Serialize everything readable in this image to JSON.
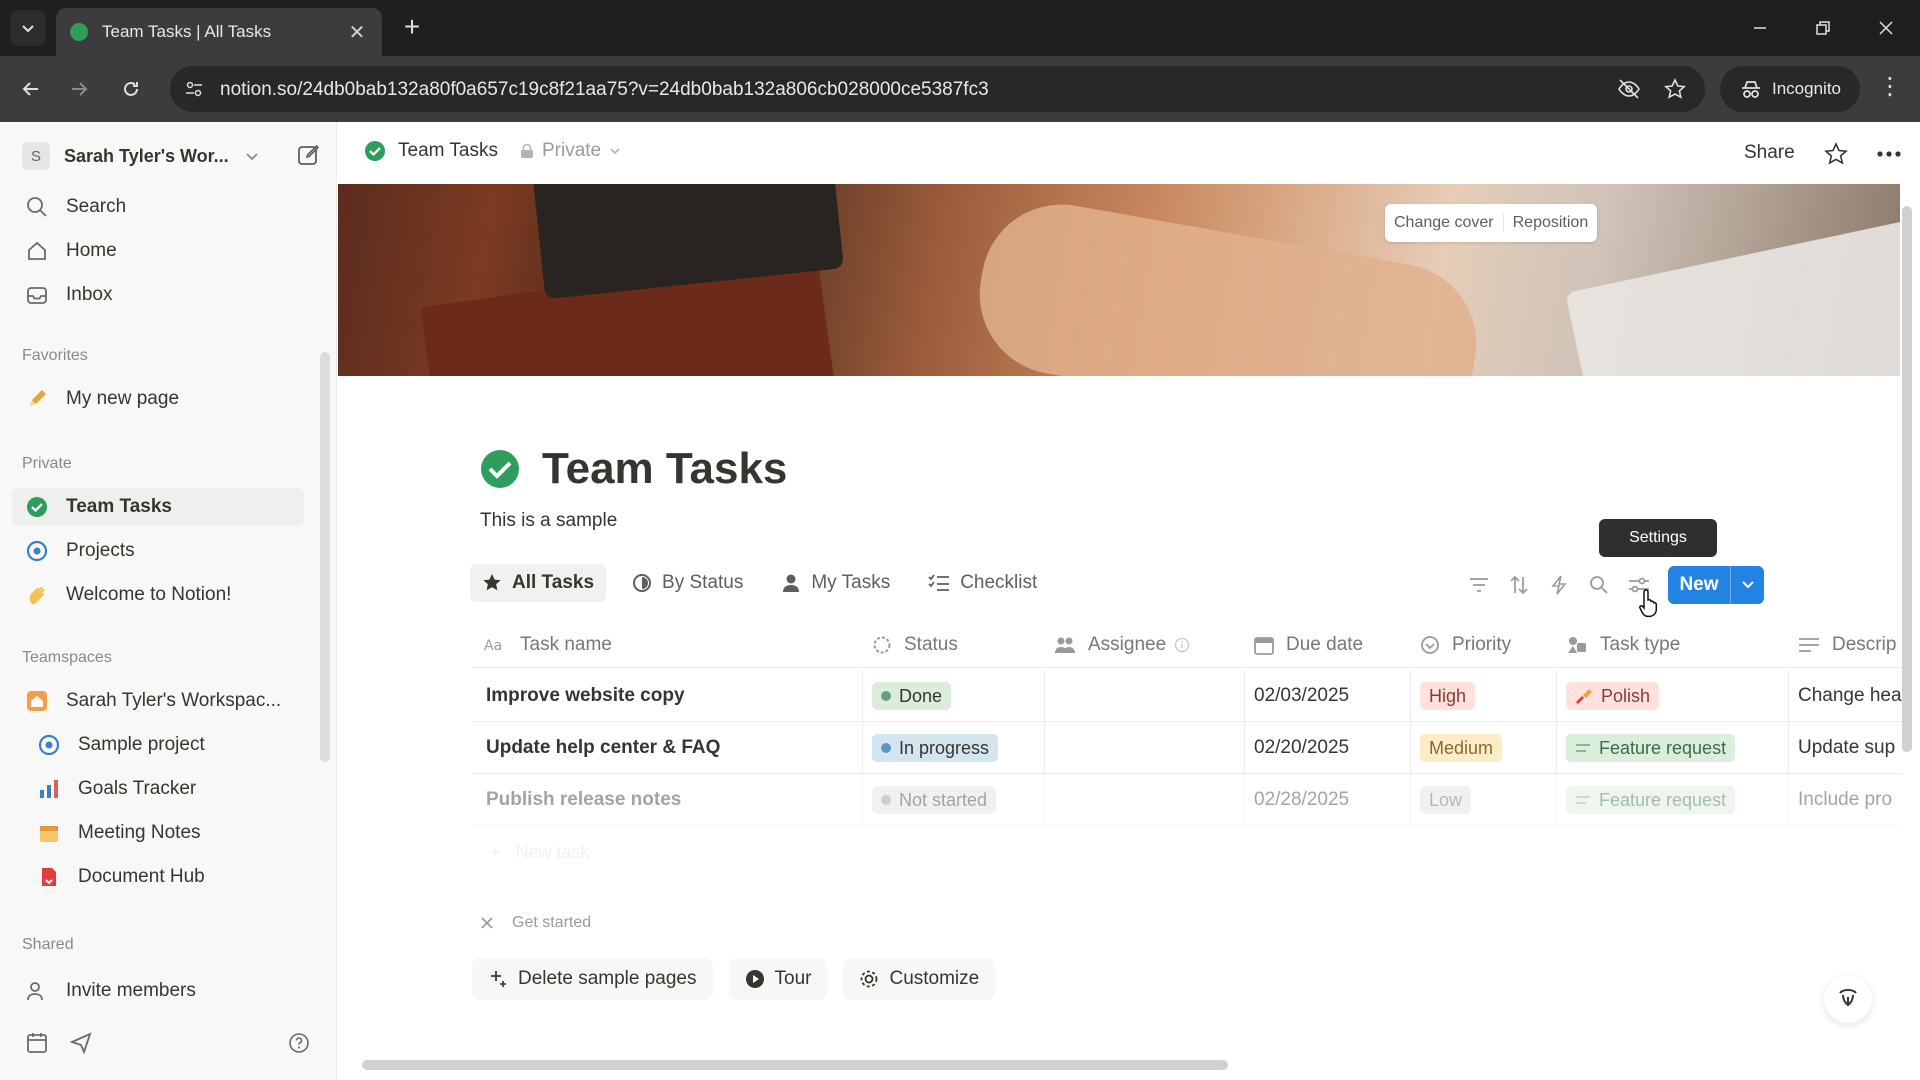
{
  "browser": {
    "tab_title": "Team Tasks | All Tasks",
    "url": "notion.so/24db0bab132a80f0a657c19c8f21aa75?v=24db0bab132a806cb028000ce5387fc3",
    "incognito_label": "Incognito"
  },
  "sidebar": {
    "workspace_initial": "S",
    "workspace_name": "Sarah Tyler's Wor...",
    "nav": [
      {
        "label": "Search",
        "icon": "search-icon"
      },
      {
        "label": "Home",
        "icon": "home-icon"
      },
      {
        "label": "Inbox",
        "icon": "inbox-icon"
      }
    ],
    "favorites_heading": "Favorites",
    "favorites": [
      {
        "label": "My new page",
        "icon": "pencil-icon"
      }
    ],
    "private_heading": "Private",
    "private": [
      {
        "label": "Team Tasks",
        "icon": "check-circle-icon"
      },
      {
        "label": "Projects",
        "icon": "target-icon"
      },
      {
        "label": "Welcome to Notion!",
        "icon": "wave-icon"
      }
    ],
    "teamspaces_heading": "Teamspaces",
    "teamspaces": [
      {
        "label": "Sarah Tyler's Workspac...",
        "icon": "house-icon"
      },
      {
        "label": "Sample project",
        "icon": "target-icon"
      },
      {
        "label": "Goals Tracker",
        "icon": "chart-icon"
      },
      {
        "label": "Meeting Notes",
        "icon": "calendar-icon"
      },
      {
        "label": "Document Hub",
        "icon": "document-icon"
      }
    ],
    "shared_heading": "Shared",
    "invite_label": "Invite members"
  },
  "topbar": {
    "page_name": "Team Tasks",
    "privacy": "Private",
    "share_label": "Share"
  },
  "cover": {
    "change_cover": "Change cover",
    "reposition": "Reposition"
  },
  "page": {
    "title": "Team Tasks",
    "description": "This is a sample"
  },
  "views": [
    {
      "label": "All Tasks",
      "icon": "star-icon"
    },
    {
      "label": "By Status",
      "icon": "status-icon"
    },
    {
      "label": "My Tasks",
      "icon": "person-icon"
    },
    {
      "label": "Checklist",
      "icon": "checklist-icon"
    }
  ],
  "toolbar": {
    "new_label": "New",
    "tooltip": "Settings"
  },
  "table": {
    "columns": [
      "Task name",
      "Status",
      "Assignee",
      "Due date",
      "Priority",
      "Task type",
      "Descrip"
    ],
    "rows": [
      {
        "name": "Improve website copy",
        "status": "Done",
        "assignee": "",
        "due": "02/03/2025",
        "priority": "High",
        "type": "Polish",
        "desc": "Change hea"
      },
      {
        "name": "Update help center & FAQ",
        "status": "In progress",
        "assignee": "",
        "due": "02/20/2025",
        "priority": "Medium",
        "type": "Feature request",
        "desc": "Update sup"
      },
      {
        "name": "Publish release notes",
        "status": "Not started",
        "assignee": "",
        "due": "02/28/2025",
        "priority": "Low",
        "type": "Feature request",
        "desc": "Include pro"
      }
    ],
    "new_task": "New task"
  },
  "get_started": {
    "label": "Get started",
    "buttons": [
      {
        "label": "Delete sample pages",
        "icon": "sparkle-icon"
      },
      {
        "label": "Tour",
        "icon": "play-icon"
      },
      {
        "label": "Customize",
        "icon": "gear-icon"
      }
    ]
  },
  "colors": {
    "accent": "#2383e2",
    "done_bg": "#dbeddb",
    "done_dot": "#6c9b7d",
    "progress_bg": "#d3e5ef",
    "progress_dot": "#5b97bd",
    "notstarted_bg": "#e3e2e0",
    "notstarted_dot": "#91918e",
    "high_bg": "#ffe2dd",
    "medium_bg": "#fdecc8",
    "low_bg": "#e3e2e0",
    "polish_bg": "#ffe2dd",
    "feature_bg": "#dbeddb"
  }
}
